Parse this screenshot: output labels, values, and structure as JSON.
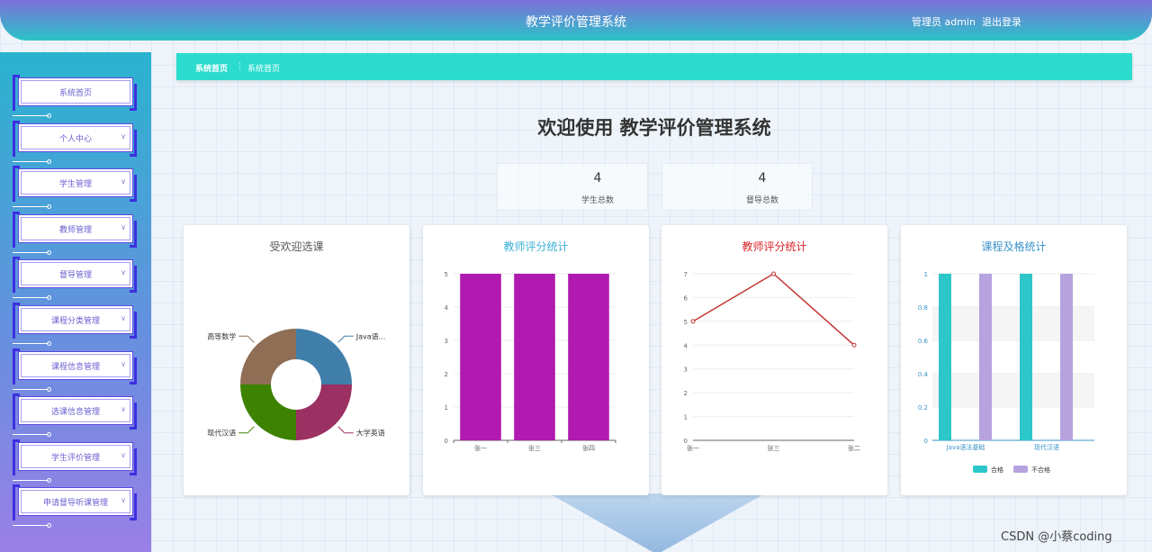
{
  "header": {
    "title": "教学评价管理系统",
    "user": "管理员 admin",
    "logout": "退出登录"
  },
  "sidebar": {
    "items": [
      {
        "label": "系统首页",
        "has_arrow": false
      },
      {
        "label": "个人中心",
        "has_arrow": true
      },
      {
        "label": "学生管理",
        "has_arrow": true
      },
      {
        "label": "教师管理",
        "has_arrow": true
      },
      {
        "label": "督导管理",
        "has_arrow": true
      },
      {
        "label": "课程分类管理",
        "has_arrow": true
      },
      {
        "label": "课程信息管理",
        "has_arrow": true
      },
      {
        "label": "选课信息管理",
        "has_arrow": true
      },
      {
        "label": "学生评价管理",
        "has_arrow": true
      },
      {
        "label": "申请督导听课管理",
        "has_arrow": true
      }
    ]
  },
  "breadcrumb": {
    "home": "系统首页",
    "current": "系统首页"
  },
  "welcome": "欢迎使用 教学评价管理系统",
  "stats": [
    {
      "value": "4",
      "label": "学生总数"
    },
    {
      "value": "4",
      "label": "督导总数"
    }
  ],
  "colors": {
    "accent": "#2bdcce",
    "bar_purple": "#b01ab0",
    "line_red": "#c23531",
    "pass": "#2ec7c9",
    "fail": "#b6a2de"
  },
  "charts": {
    "popular": {
      "title": "受欢迎选课",
      "title_color": "#555555"
    },
    "teacher_bar": {
      "title": "教师评分统计",
      "title_color": "#3bb0d6"
    },
    "teacher_line": {
      "title": "教师评分统计",
      "title_color": "#d8242a"
    },
    "pass_rate": {
      "title": "课程及格统计",
      "title_color": "#3a94c8"
    }
  },
  "chart_data": [
    {
      "type": "pie",
      "title": "受欢迎选课",
      "categories": [
        "Java语...",
        "大学英语",
        "现代汉语",
        "高等数学"
      ],
      "values": [
        1,
        1,
        1,
        1
      ],
      "colors": [
        "#3f7faa",
        "#9b3063",
        "#3d8200",
        "#8f6e55"
      ]
    },
    {
      "type": "bar",
      "title": "教师评分统计",
      "categories": [
        "张一",
        "张三",
        "张四"
      ],
      "values": [
        5,
        5,
        5
      ],
      "ylim": [
        0,
        5
      ],
      "yticks": [
        0,
        1,
        2,
        3,
        4,
        5
      ]
    },
    {
      "type": "line",
      "title": "教师评分统计",
      "categories": [
        "张一",
        "张三",
        "张二"
      ],
      "values": [
        5,
        7,
        4
      ],
      "ylim": [
        0,
        7
      ],
      "yticks": [
        0,
        1,
        2,
        3,
        4,
        5,
        6,
        7
      ]
    },
    {
      "type": "bar",
      "title": "课程及格统计",
      "categories": [
        "Java语法基础",
        "现代汉语"
      ],
      "series": [
        {
          "name": "合格",
          "values": [
            1,
            1
          ]
        },
        {
          "name": "不合格",
          "values": [
            1,
            1
          ]
        }
      ],
      "ylim": [
        0,
        1
      ],
      "yticks": [
        0,
        0.2,
        0.4,
        0.6,
        0.8,
        1
      ],
      "legend": "bottom"
    }
  ]
}
